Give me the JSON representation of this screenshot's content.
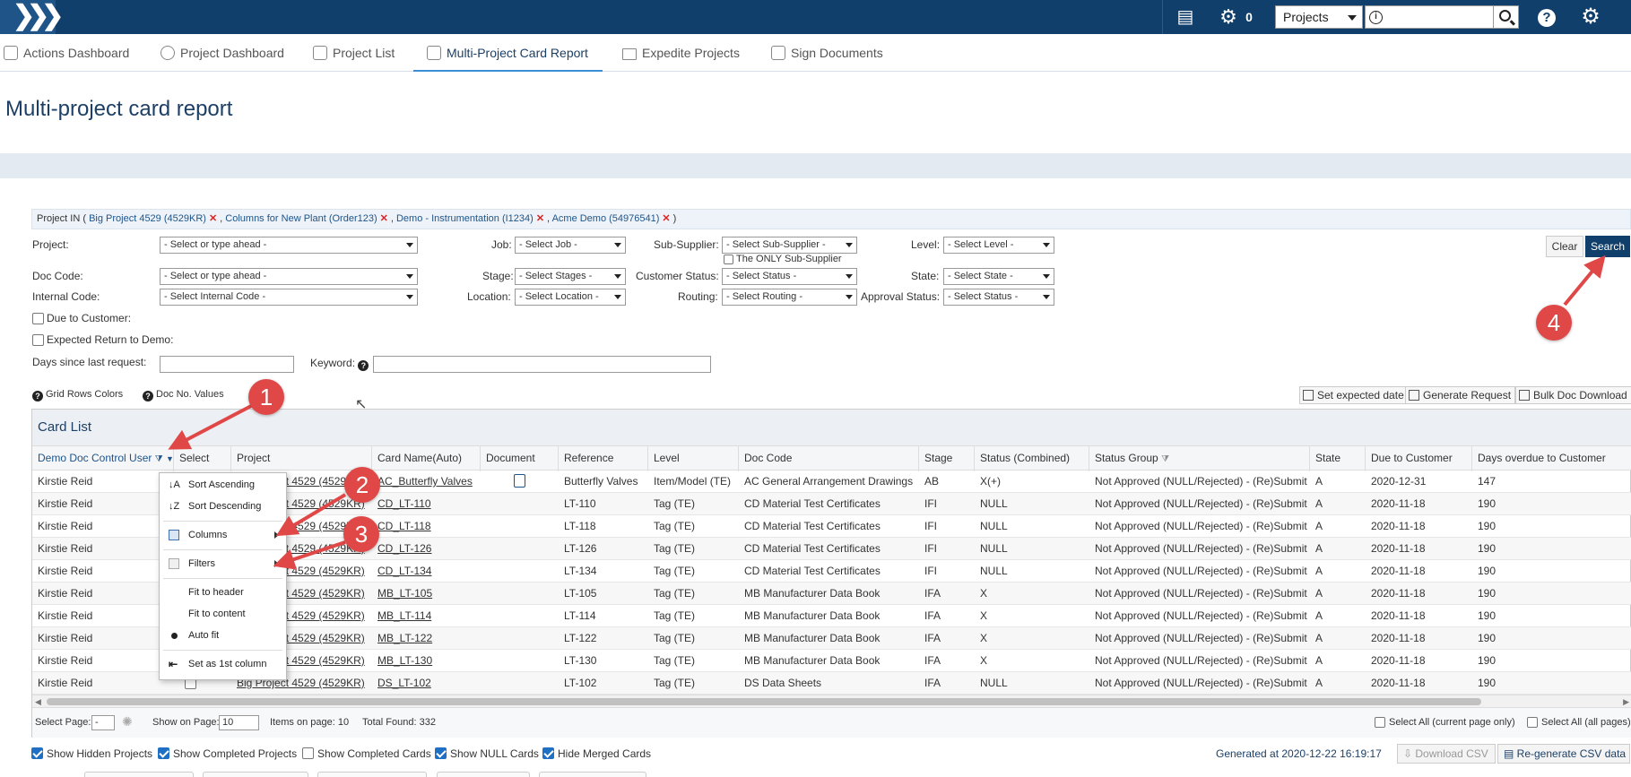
{
  "topbar": {
    "count": "0",
    "project_select": "Projects",
    "icons": [
      "logo-chevrons-icon",
      "report-icon",
      "gears-icon",
      "help-icon",
      "settings-icon"
    ]
  },
  "nav": {
    "tabs": [
      {
        "label": "Actions Dashboard",
        "icon": "actions-dashboard-icon"
      },
      {
        "label": "Project Dashboard",
        "icon": "project-dashboard-icon"
      },
      {
        "label": "Project List",
        "icon": "project-list-icon"
      },
      {
        "label": "Multi-Project Card Report",
        "icon": "card-report-icon",
        "active": true
      },
      {
        "label": "Expedite Projects",
        "icon": "envelope-icon"
      },
      {
        "label": "Sign Documents",
        "icon": "sign-icon"
      }
    ]
  },
  "page": {
    "title": "Multi-project card report"
  },
  "filter_chips": {
    "prefix": "Project IN (",
    "items": [
      "Big Project 4529 (4529KR)",
      "Columns for New Plant (Order123)",
      "Demo - Instrumentation (I1234)",
      "Acme Demo (54976541)"
    ],
    "suffix": ")"
  },
  "filters": {
    "project_label": "Project:",
    "project_placeholder": "- Select or type ahead -",
    "doccode_label": "Doc Code:",
    "doccode_placeholder": "- Select or type ahead -",
    "internal_label": "Internal Code:",
    "internal_placeholder": "- Select Internal Code -",
    "due_label": "Due to Customer:",
    "expected_label": "Expected Return to Demo:",
    "days_label": "Days since last request:",
    "keyword_label": "Keyword:",
    "job_label": "Job:",
    "job_value": "- Select Job -",
    "stage_label": "Stage:",
    "stage_value": "- Select Stages -",
    "location_label": "Location:",
    "location_value": "- Select Location -",
    "subsupplier_label": "Sub-Supplier:",
    "subsupplier_value": "- Select Sub-Supplier -",
    "only_sub_label": "The ONLY Sub-Supplier",
    "custstatus_label": "Customer Status:",
    "custstatus_value": "- Select Status -",
    "routing_label": "Routing:",
    "routing_value": "- Select Routing -",
    "level_label": "Level:",
    "level_value": "- Select Level -",
    "state_label": "State:",
    "state_value": "- Select State -",
    "approval_label": "Approval Status:",
    "approval_value": "- Select Status -",
    "clear": "Clear",
    "search": "Search"
  },
  "legend_links": {
    "grid_rows": "Grid Rows Colors",
    "doc_no": "Doc No. Values"
  },
  "toolbar": {
    "set_expected": "Set expected date",
    "generate": "Generate Request",
    "bulk": "Bulk Doc Download"
  },
  "grid": {
    "title": "Card List",
    "columns": [
      "Demo Doc Control User",
      "Select",
      "Project",
      "Card Name(Auto)",
      "Document",
      "Reference",
      "Level",
      "Doc Code",
      "Stage",
      "Status (Combined)",
      "Status Group",
      "State",
      "Due to Customer",
      "Days overdue to Customer"
    ],
    "rows": [
      [
        "Kirstie Reid",
        "",
        "Big Project 4529 (4529KR)",
        "AC_Butterfly Valves",
        "doc",
        "Butterfly Valves",
        "Item/Model (TE)",
        "AC General Arrangement Drawings",
        "AB",
        "X(+)",
        "Not Approved (NULL/Rejected) - (Re)Submit",
        "A",
        "2020-12-31",
        "147"
      ],
      [
        "Kirstie Reid",
        "",
        "Big Project 4529 (4529KR)",
        "CD_LT-110",
        "",
        "LT-110",
        "Tag (TE)",
        "CD Material Test Certificates",
        "IFI",
        "NULL",
        "Not Approved (NULL/Rejected) - (Re)Submit",
        "A",
        "2020-11-18",
        "190"
      ],
      [
        "Kirstie Reid",
        "",
        "Big Project 4529 (4529KR)",
        "CD_LT-118",
        "",
        "LT-118",
        "Tag (TE)",
        "CD Material Test Certificates",
        "IFI",
        "NULL",
        "Not Approved (NULL/Rejected) - (Re)Submit",
        "A",
        "2020-11-18",
        "190"
      ],
      [
        "Kirstie Reid",
        "",
        "Big Project 4529 (4529KR)",
        "CD_LT-126",
        "",
        "LT-126",
        "Tag (TE)",
        "CD Material Test Certificates",
        "IFI",
        "NULL",
        "Not Approved (NULL/Rejected) - (Re)Submit",
        "A",
        "2020-11-18",
        "190"
      ],
      [
        "Kirstie Reid",
        "",
        "Big Project 4529 (4529KR)",
        "CD_LT-134",
        "",
        "LT-134",
        "Tag (TE)",
        "CD Material Test Certificates",
        "IFI",
        "NULL",
        "Not Approved (NULL/Rejected) - (Re)Submit",
        "A",
        "2020-11-18",
        "190"
      ],
      [
        "Kirstie Reid",
        "",
        "Big Project 4529 (4529KR)",
        "MB_LT-105",
        "",
        "LT-105",
        "Tag (TE)",
        "MB Manufacturer Data Book",
        "IFA",
        "X",
        "Not Approved (NULL/Rejected) - (Re)Submit",
        "A",
        "2020-11-18",
        "190"
      ],
      [
        "Kirstie Reid",
        "",
        "Big Project 4529 (4529KR)",
        "MB_LT-114",
        "",
        "LT-114",
        "Tag (TE)",
        "MB Manufacturer Data Book",
        "IFA",
        "X",
        "Not Approved (NULL/Rejected) - (Re)Submit",
        "A",
        "2020-11-18",
        "190"
      ],
      [
        "Kirstie Reid",
        "",
        "Big Project 4529 (4529KR)",
        "MB_LT-122",
        "",
        "LT-122",
        "Tag (TE)",
        "MB Manufacturer Data Book",
        "IFA",
        "X",
        "Not Approved (NULL/Rejected) - (Re)Submit",
        "A",
        "2020-11-18",
        "190"
      ],
      [
        "Kirstie Reid",
        "",
        "Big Project 4529 (4529KR)",
        "MB_LT-130",
        "",
        "LT-130",
        "Tag (TE)",
        "MB Manufacturer Data Book",
        "IFA",
        "X",
        "Not Approved (NULL/Rejected) - (Re)Submit",
        "A",
        "2020-11-18",
        "190"
      ],
      [
        "Kirstie Reid",
        "",
        "Big Project 4529 (4529KR)",
        "DS_LT-102",
        "",
        "LT-102",
        "Tag (TE)",
        "DS Data Sheets",
        "IFA",
        "NULL",
        "Not Approved (NULL/Rejected) - (Re)Submit",
        "A",
        "2020-11-18",
        "190"
      ]
    ]
  },
  "pager": {
    "select_page": "Select Page:",
    "page_value": "-",
    "show_on_page": "Show on Page:",
    "show_value": "10",
    "items_on_page": "Items on page: 10",
    "total_found": "Total Found: 332",
    "select_all_current": "Select All (current page only)",
    "select_all": "Select All (all pages)"
  },
  "context_menu": {
    "items": [
      {
        "label": "Sort Ascending",
        "icon": "sort-ascending-icon"
      },
      {
        "label": "Sort Descending",
        "icon": "sort-descending-icon"
      },
      {
        "label": "Columns",
        "icon": "columns-icon",
        "submenu": true
      },
      {
        "label": "Filters",
        "icon": "filters-icon",
        "submenu": true
      },
      {
        "label": "Fit to header",
        "icon": ""
      },
      {
        "label": "Fit to content",
        "icon": ""
      },
      {
        "label": "Auto fit",
        "icon": "dot-icon"
      },
      {
        "label": "Set as 1st column",
        "icon": "pin-first-icon"
      }
    ]
  },
  "annotations": {
    "badges": [
      "1",
      "2",
      "3",
      "4"
    ],
    "color": "#e04848"
  },
  "footer": {
    "show_hidden": "Show Hidden Projects",
    "show_completed_projects": "Show Completed Projects",
    "show_completed_cards": "Show Completed Cards",
    "show_null": "Show NULL Cards",
    "hide_merged": "Hide Merged Cards",
    "generated": "Generated at 2020-12-22 16:19:17",
    "download_csv": "Download CSV",
    "regen_csv": "Re-generate CSV data"
  },
  "colors": {
    "brand": "#103f6c",
    "accent": "#3b8fd8",
    "link": "#1f5488"
  }
}
